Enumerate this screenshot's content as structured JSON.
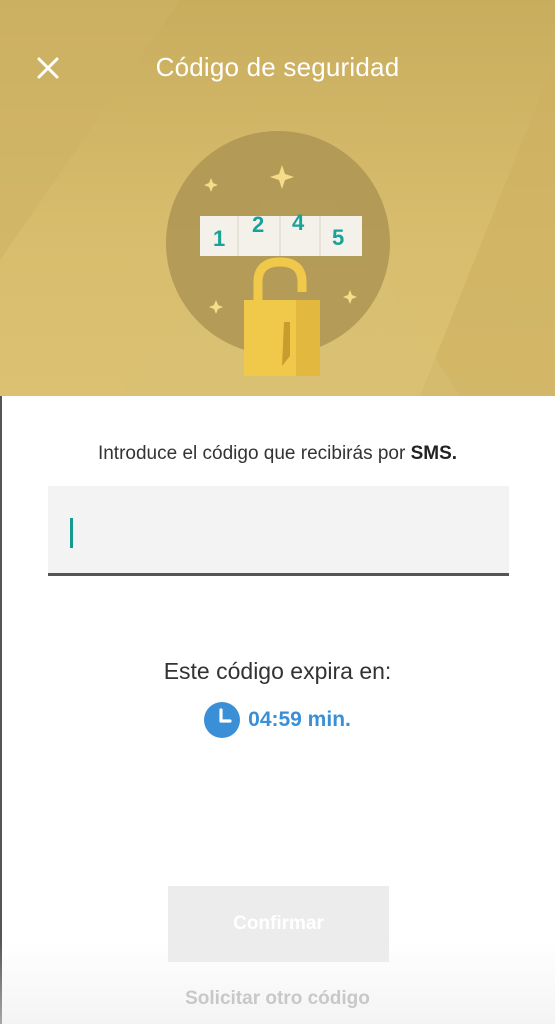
{
  "header": {
    "title": "Código de seguridad",
    "close_icon": "close-icon",
    "background_color": "#d4b867"
  },
  "illustration": {
    "digits": [
      "1",
      "2",
      "4",
      "5"
    ],
    "digit_color": "#18a398",
    "lock_color": "#f0c94a",
    "sparkle_color": "#f6dc8a"
  },
  "form": {
    "instruction_prefix": "Introduce el código que recibirás por ",
    "instruction_bold": "SMS.",
    "code_value": "",
    "caret_color": "#159a8f"
  },
  "expiry": {
    "label": "Este código expira en:",
    "time": "04:59 min.",
    "clock_icon": "clock-icon",
    "accent_color": "#3a8fd6"
  },
  "actions": {
    "confirm_label": "Confirmar",
    "request_label": "Solicitar otro código"
  }
}
